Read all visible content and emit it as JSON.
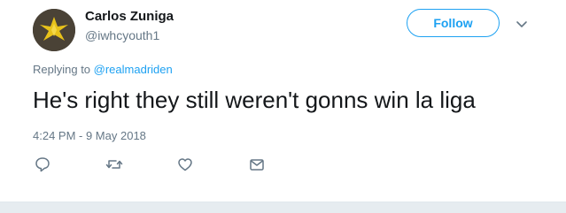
{
  "tweet": {
    "author_name": "Carlos Zuniga",
    "author_handle": "@iwhcyouth1",
    "follow_label": "Follow",
    "replying_prefix": "Replying to ",
    "replying_to": "@realmadriden",
    "text": "He's right they still weren't gonns win la liga",
    "timestamp": "4:24 PM - 9 May 2018"
  },
  "icons": {
    "reply": "reply-icon",
    "retweet": "retweet-icon",
    "like": "heart-icon",
    "message": "envelope-icon",
    "more": "chevron-down-icon"
  },
  "colors": {
    "accent": "#1da1f2",
    "muted": "#657786",
    "text": "#14171a"
  }
}
